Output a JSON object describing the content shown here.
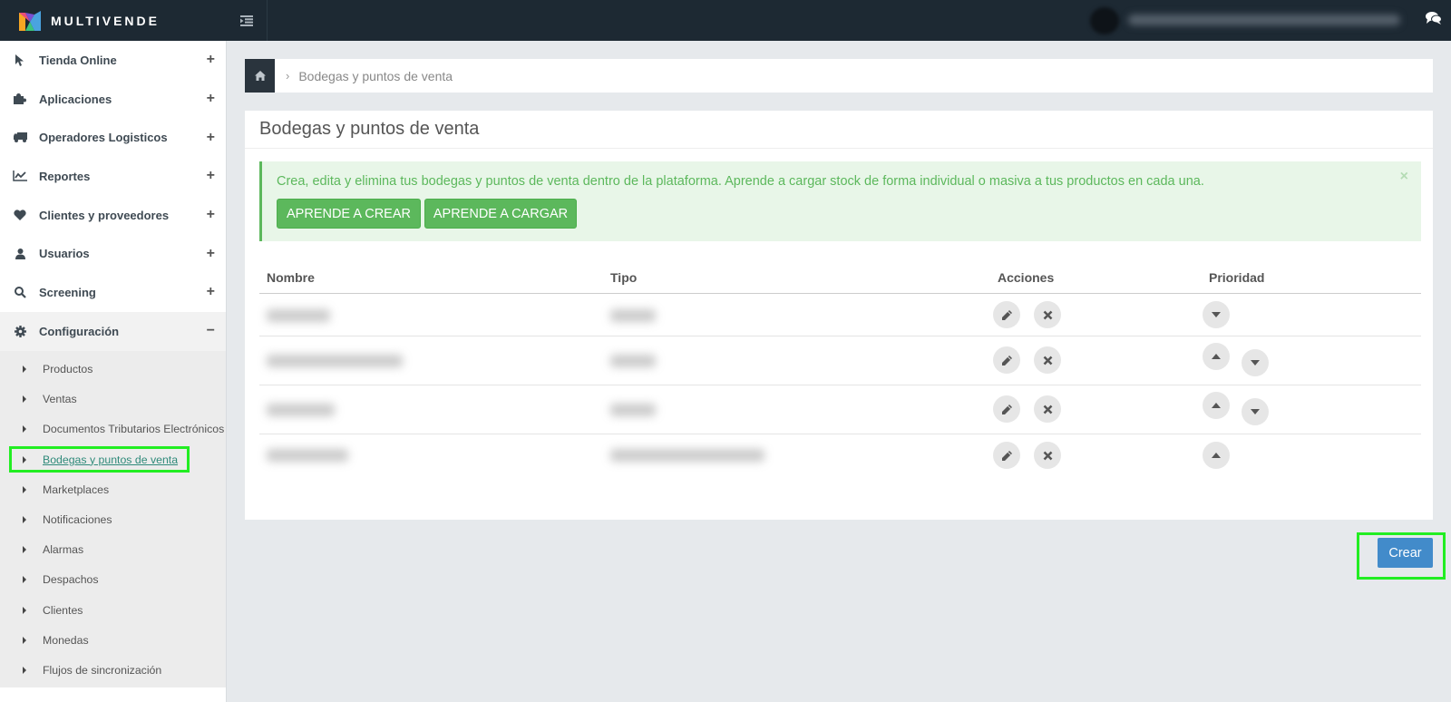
{
  "app": {
    "brand": "MULTIVENDE"
  },
  "sidebar": {
    "items": [
      {
        "label": "Tienda Online",
        "icon": "pointer-icon",
        "toggle": "+"
      },
      {
        "label": "Aplicaciones",
        "icon": "puzzle-icon",
        "toggle": "+"
      },
      {
        "label": "Operadores Logisticos",
        "icon": "truck-icon",
        "toggle": "+"
      },
      {
        "label": "Reportes",
        "icon": "chart-line-icon",
        "toggle": "+"
      },
      {
        "label": "Clientes y proveedores",
        "icon": "heart-icon",
        "toggle": "+"
      },
      {
        "label": "Usuarios",
        "icon": "user-icon",
        "toggle": "+"
      },
      {
        "label": "Screening",
        "icon": "search-icon",
        "toggle": "+"
      },
      {
        "label": "Configuración",
        "icon": "gear-icon",
        "toggle": "−"
      }
    ],
    "submenu": [
      {
        "label": "Productos"
      },
      {
        "label": "Ventas"
      },
      {
        "label": "Documentos Tributarios Electrónicos"
      },
      {
        "label": "Bodegas y puntos de venta"
      },
      {
        "label": "Marketplaces"
      },
      {
        "label": "Notificaciones"
      },
      {
        "label": "Alarmas"
      },
      {
        "label": "Despachos"
      },
      {
        "label": "Clientes"
      },
      {
        "label": "Monedas"
      },
      {
        "label": "Flujos de sincronización"
      }
    ]
  },
  "breadcrumb": {
    "current": "Bodegas y puntos de venta"
  },
  "panel": {
    "title": "Bodegas y puntos de venta"
  },
  "alert": {
    "text": "Crea, edita y elimina tus bodegas y puntos de venta dentro de la plataforma. Aprende a cargar stock de forma individual o masiva a tus productos en cada una.",
    "close": "×",
    "btn_create": "APRENDE A CREAR",
    "btn_load": "APRENDE A CARGAR"
  },
  "table": {
    "headers": [
      "Nombre",
      "Tipo",
      "Acciones",
      "Prioridad"
    ],
    "rows": [
      {
        "priority_up": false,
        "priority_down": true
      },
      {
        "priority_up": true,
        "priority_down": true
      },
      {
        "priority_up": true,
        "priority_down": true
      },
      {
        "priority_up": true,
        "priority_down": false
      }
    ]
  },
  "actions": {
    "create": "Crear"
  },
  "colors": {
    "topbar": "#1d2933",
    "success": "#5cb85c",
    "primary": "#428bca",
    "highlight": "#22ee22"
  }
}
